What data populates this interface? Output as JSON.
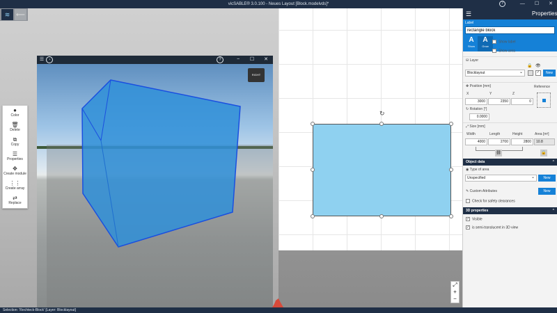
{
  "window": {
    "title": "vicSABLE® 3.0.100 - Neues Layout [Block.modelvds]*",
    "help": "?",
    "minimize": "—",
    "maximize": "☐",
    "close": "✕"
  },
  "topbar": {
    "logo": "≋",
    "back": "⟵"
  },
  "toolbox": {
    "items": [
      {
        "label": "Color",
        "icon": "●"
      },
      {
        "label": "Delete",
        "icon": "🗑"
      },
      {
        "label": "Copy",
        "icon": "⧉"
      },
      {
        "label": "Properties",
        "icon": "☰"
      },
      {
        "label": "Create module",
        "icon": "✥"
      },
      {
        "label": "Create array",
        "icon": "⋮⋮"
      },
      {
        "label": "Replace",
        "icon": "⇄"
      }
    ]
  },
  "camera": {
    "menu": "☰",
    "help": "?",
    "minimize": "−",
    "maximize": "☐",
    "close": "✕",
    "cube_label": "RIGHT"
  },
  "plan": {
    "rotate_glyph": "↻",
    "zoom_fit": "⤢",
    "zoom_in": "+",
    "zoom_out": "−"
  },
  "status": {
    "text": "Selection: 'Rechteck-Block' [Layer: Blocklayout]"
  },
  "props": {
    "title": "Properties",
    "label_caption": "Label",
    "label_value": "rectangle block",
    "format_a1": "A",
    "format_a1_caption": "Show",
    "format_a2": "A",
    "format_a2_caption": "Grow",
    "show_label": "Show label",
    "show_area": "Show area",
    "layer_caption": "Layer",
    "layer_value": "Blocklayout",
    "new_label": "New",
    "position_caption": "Position [mm]",
    "reference_caption": "Reference",
    "axis_x": "X",
    "axis_y": "Y",
    "axis_z": "Z",
    "pos_x": "3000",
    "pos_y": "2350",
    "pos_z": "0",
    "rotation_caption": "Rotation [°]",
    "rotation_value": "0.0000",
    "size_caption": "Size [mm]",
    "width_label": "Width",
    "length_label": "Length",
    "height_label": "Height",
    "area_label": "Area [m²]",
    "width": "4000",
    "length": "2700",
    "height": "2800",
    "area": "10.8",
    "object_data": "Object data",
    "type_of_area": "Type of area",
    "type_value": "Unspecified",
    "custom_attributes": "Custom Attributes",
    "check_safety": "Check for safety clearances",
    "props3d": "3D properties",
    "visible": "Visible",
    "semi_trans": "is semi-translucent in 3D view"
  },
  "colors": {
    "accent": "#1581d7",
    "dark": "#1f2f46",
    "block": "#8fd1f0",
    "block3d": "#2f8fd8"
  }
}
